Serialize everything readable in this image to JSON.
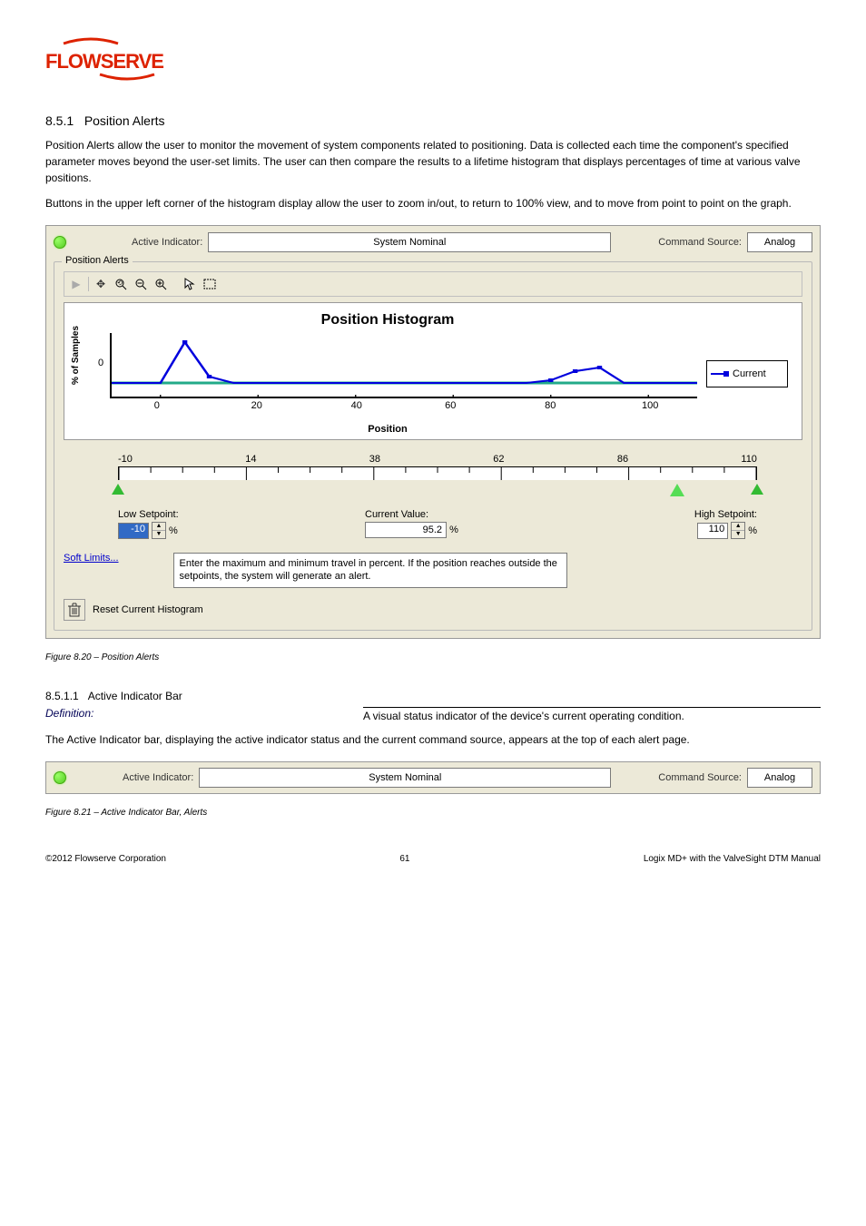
{
  "page_heading_num": "8.5.1",
  "page_heading": "Position Alerts",
  "intro_p1": "Position Alerts allow the user to monitor the movement of system components related to positioning. Data is collected each time the component's specified parameter moves beyond the user-set limits. The user can then compare the results to a lifetime histogram that displays percentages of time at various valve positions.",
  "intro_p2": "Buttons in the upper left corner of the histogram display allow the user to zoom in/out, to return to 100% view, and to move from point to point on the graph.",
  "top_bar": {
    "active_indicator_label": "Active Indicator:",
    "active_indicator_value": "System Nominal",
    "command_source_label": "Command Source:",
    "command_source_value": "Analog"
  },
  "groupbox_title": "Position Alerts",
  "chart": {
    "title": "Position Histogram",
    "ylabel": "% of Samples",
    "xlabel": "Position",
    "legend": "Current",
    "y_tick": "0",
    "x_ticks": [
      "0",
      "20",
      "40",
      "60",
      "80",
      "100"
    ]
  },
  "ruler": {
    "labels": [
      "-10",
      "14",
      "38",
      "62",
      "86",
      "110"
    ]
  },
  "low_sp_label": "Low Setpoint:",
  "low_sp_value": "-10",
  "curr_label": "Current Value:",
  "curr_value": "95.2",
  "high_sp_label": "High Setpoint:",
  "high_sp_value": "110",
  "unit": "%",
  "soft_limits_link": "Soft Limits...",
  "help_text": "Enter the maximum and minimum travel in percent.  If the position reaches outside the setpoints, the system will generate an alert.",
  "reset_label": "Reset Current Histogram",
  "figure_caption": "Figure 8.20 – Position Alerts",
  "active_indicator_section": {
    "num": "8.5.1.1",
    "title": "Active Indicator Bar",
    "definition_label": "Definition:",
    "definition_text": "A visual status indicator of the device's current operating condition.",
    "p1": "The Active Indicator bar, displaying the active indicator status and the current command source, appears at the top of each alert page.",
    "figure_caption": "Figure 8.21 – Active Indicator Bar, Alerts"
  },
  "chart_data": {
    "type": "line",
    "title": "Position Histogram",
    "xlabel": "Position",
    "ylabel": "% of Samples",
    "xlim": [
      -10,
      110
    ],
    "x_ticks": [
      0,
      20,
      40,
      60,
      80,
      100
    ],
    "series": [
      {
        "name": "Current",
        "x": [
          -10,
          -5,
          0,
          5,
          10,
          15,
          20,
          25,
          30,
          35,
          40,
          45,
          50,
          55,
          60,
          65,
          70,
          75,
          80,
          85,
          90,
          95,
          100,
          105,
          110
        ],
        "values": [
          0,
          0,
          0,
          62,
          10,
          0,
          0,
          0,
          0,
          0,
          0,
          0,
          0,
          0,
          0,
          0,
          0,
          0,
          0,
          5,
          18,
          22,
          0,
          0,
          0
        ]
      }
    ]
  },
  "footer": {
    "left": "©2012 Flowserve Corporation",
    "center": "61",
    "right": "Logix MD+ with the ValveSight DTM Manual"
  }
}
